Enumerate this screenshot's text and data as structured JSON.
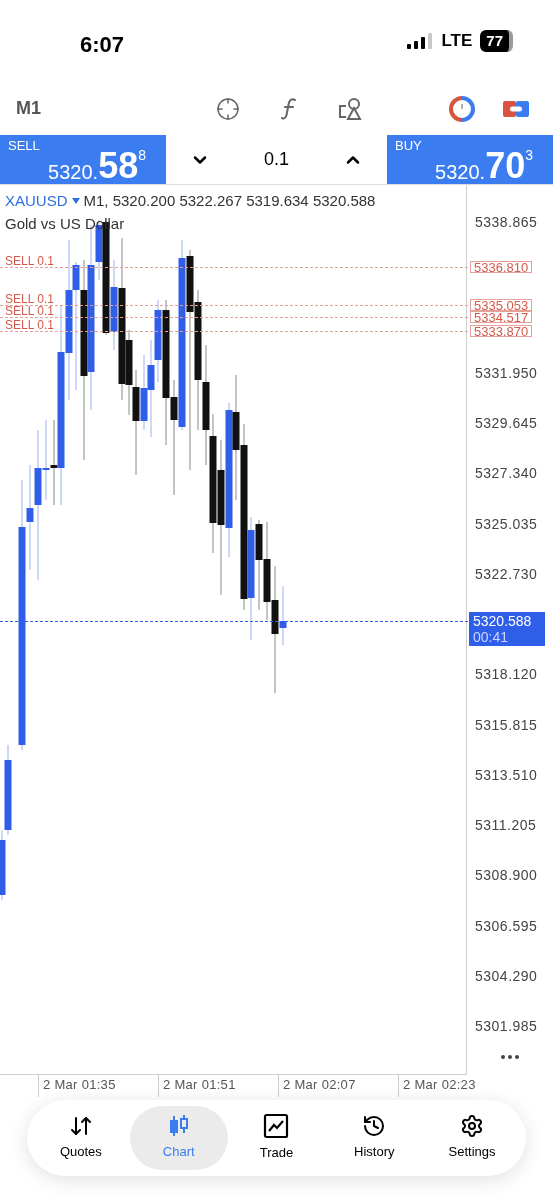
{
  "status_bar": {
    "time": "6:07",
    "network": "LTE",
    "battery": "77"
  },
  "toolbar": {
    "timeframe": "M1"
  },
  "trade_bar": {
    "sell": {
      "label": "SELL",
      "price_small": "5320.",
      "price_big": "58",
      "price_sup": "8"
    },
    "volume": "0.1",
    "buy": {
      "label": "BUY",
      "price_small": "5320.",
      "price_big": "70",
      "price_sup": "3"
    }
  },
  "chart": {
    "symbol": "XAUUSD",
    "info": "M1, 5320.200 5322.267 5319.634 5320.588",
    "description": "Gold vs US Dollar",
    "orders": [
      {
        "label": "SELL 0.1",
        "price": "5336.810"
      },
      {
        "label": "SELL 0.1",
        "price": "5335.053"
      },
      {
        "label": "SELL 0.1",
        "price": "5334.517"
      },
      {
        "label": "SELL 0.1",
        "price": "5333.870"
      }
    ],
    "current_price": "5320.588",
    "countdown": "00:41",
    "y_labels": [
      "5338.865",
      "5331.950",
      "5329.645",
      "5327.340",
      "5325.035",
      "5322.730",
      "5318.120",
      "5315.815",
      "5313.510",
      "5311.205",
      "5308.900",
      "5306.595",
      "5304.290",
      "5301.985"
    ],
    "x_labels": [
      "2 Mar 01:35",
      "2 Mar 01:51",
      "2 Mar 02:07",
      "2 Mar 02:23"
    ]
  },
  "nav": [
    {
      "label": "Quotes",
      "selected": false
    },
    {
      "label": "Chart",
      "selected": true
    },
    {
      "label": "Trade",
      "selected": false
    },
    {
      "label": "History",
      "selected": false
    },
    {
      "label": "Settings",
      "selected": false
    }
  ]
}
